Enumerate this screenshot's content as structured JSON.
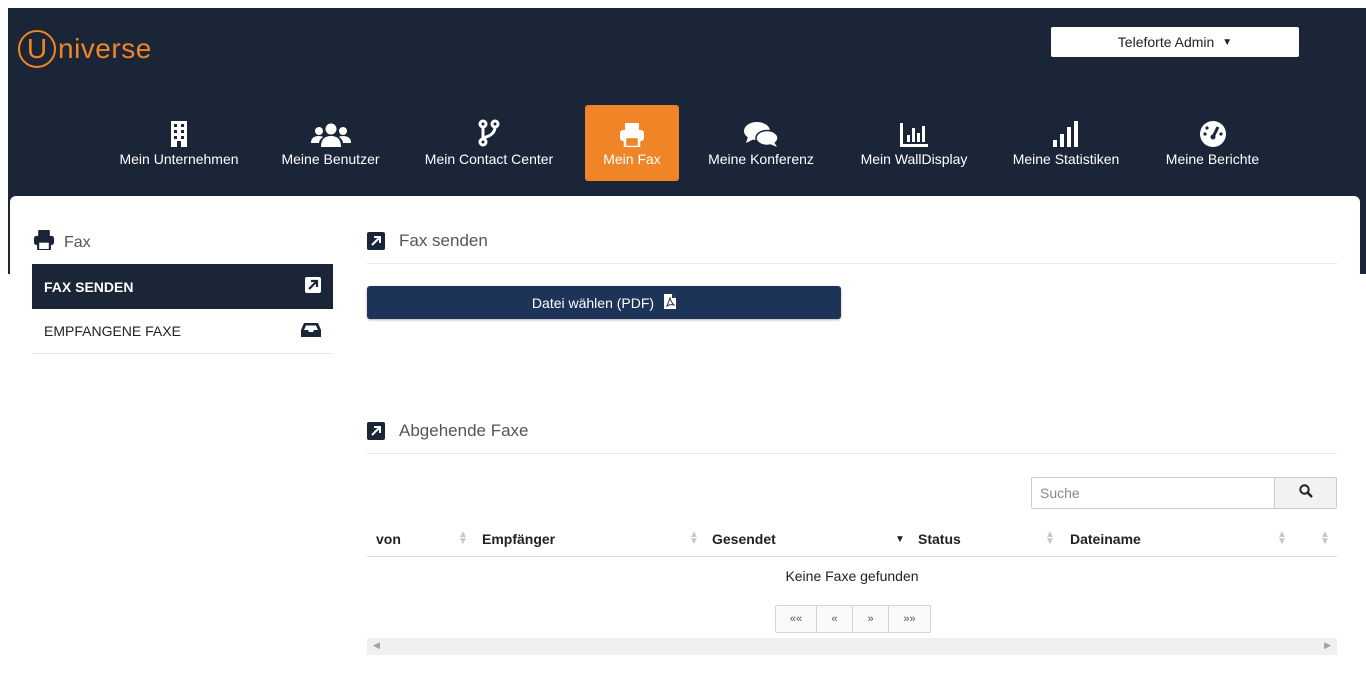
{
  "app": {
    "logo_letter": "U",
    "logo_rest": "niverse"
  },
  "user_menu": {
    "label": "Teleforte Admin",
    "caret": "▼"
  },
  "nav": [
    {
      "label": "Mein Unternehmen",
      "icon": "building-icon"
    },
    {
      "label": "Meine Benutzer",
      "icon": "users-icon"
    },
    {
      "label": "Mein Contact Center",
      "icon": "branch-icon"
    },
    {
      "label": "Mein Fax",
      "icon": "printer-icon",
      "active": true
    },
    {
      "label": "Meine Konferenz",
      "icon": "chat-bubbles-icon"
    },
    {
      "label": "Mein WallDisplay",
      "icon": "bar-chart-icon"
    },
    {
      "label": "Meine Statistiken",
      "icon": "signal-bars-icon"
    },
    {
      "label": "Meine Berichte",
      "icon": "dashboard-icon"
    }
  ],
  "sidebar": {
    "title": "Fax",
    "items": [
      {
        "label": "FAX SENDEN",
        "icon": "external-link-icon",
        "active": true
      },
      {
        "label": "EMPFANGENE FAXE",
        "icon": "inbox-icon"
      }
    ]
  },
  "send_section": {
    "title": "Fax senden",
    "upload_label": "Datei wählen (PDF)"
  },
  "outgoing_section": {
    "title": "Abgehende Faxe",
    "search_placeholder": "Suche",
    "columns": [
      "von",
      "Empfänger",
      "Gesendet",
      "Status",
      "Dateiname"
    ],
    "empty_message": "Keine Faxe gefunden",
    "pager": [
      "««",
      "«",
      "»",
      "»»"
    ]
  },
  "colors": {
    "navy": "#1b2538",
    "orange": "#ef8527",
    "button_blue": "#1e3358"
  }
}
